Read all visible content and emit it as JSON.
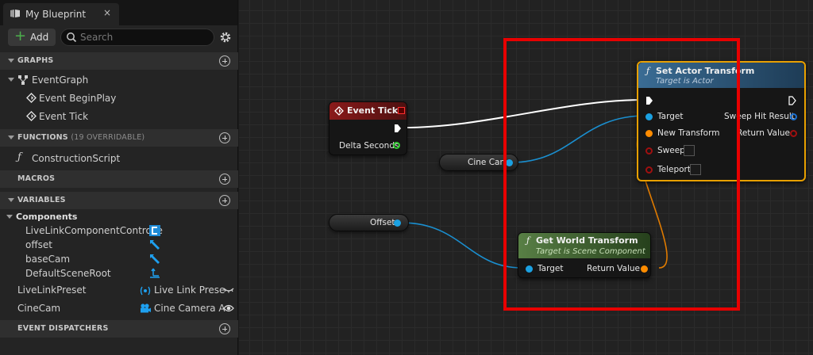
{
  "tab": {
    "title": "My Blueprint",
    "close": "×"
  },
  "toolbar": {
    "add_label": "Add",
    "search_placeholder": "Search"
  },
  "sections": {
    "graphs": "GRAPHS",
    "functions": "FUNCTIONS",
    "functions_count": "(19 OVERRIDABLE)",
    "macros": "MACROS",
    "variables": "VARIABLES",
    "event_dispatchers": "EVENT DISPATCHERS"
  },
  "graphs": {
    "event_graph": "EventGraph",
    "items": [
      "Event BeginPlay",
      "Event Tick"
    ]
  },
  "functions": {
    "items": [
      "ConstructionScript"
    ]
  },
  "variables": {
    "components_label": "Components",
    "components": [
      "LiveLinkComponentControlle",
      "offset",
      "baseCam",
      "DefaultSceneRoot"
    ],
    "vars": [
      {
        "name": "LiveLinkPreset",
        "type": "Live Link Prese"
      },
      {
        "name": "CineCam",
        "type": "Cine Camera A"
      }
    ]
  },
  "nodes": {
    "event_tick": {
      "title": "Event Tick",
      "pin_delta": "Delta Seconds"
    },
    "cine_cam": {
      "label": "Cine Cam"
    },
    "offset": {
      "label": "Offset"
    },
    "set_actor_transform": {
      "title": "Set Actor Transform",
      "subtitle": "Target is Actor",
      "pins": {
        "target": "Target",
        "new_transform": "New Transform",
        "sweep": "Sweep",
        "teleport": "Teleport",
        "sweep_hit_result": "Sweep Hit Result",
        "return_value": "Return Value"
      }
    },
    "get_world_transform": {
      "title": "Get World Transform",
      "subtitle": "Target is Scene Component",
      "pins": {
        "target": "Target",
        "return_value": "Return Value"
      }
    }
  },
  "colors": {
    "exec": "#ffffff",
    "object_pin": "#1ba1e2",
    "struct_pin": "#ff8c00",
    "bool_pin": "#8b0000",
    "float_pin": "#32cd32",
    "event_header": "#7a1515",
    "function_header": "#2e5d86",
    "pure_header": "#4d7a3c",
    "highlight": "#e80000"
  }
}
